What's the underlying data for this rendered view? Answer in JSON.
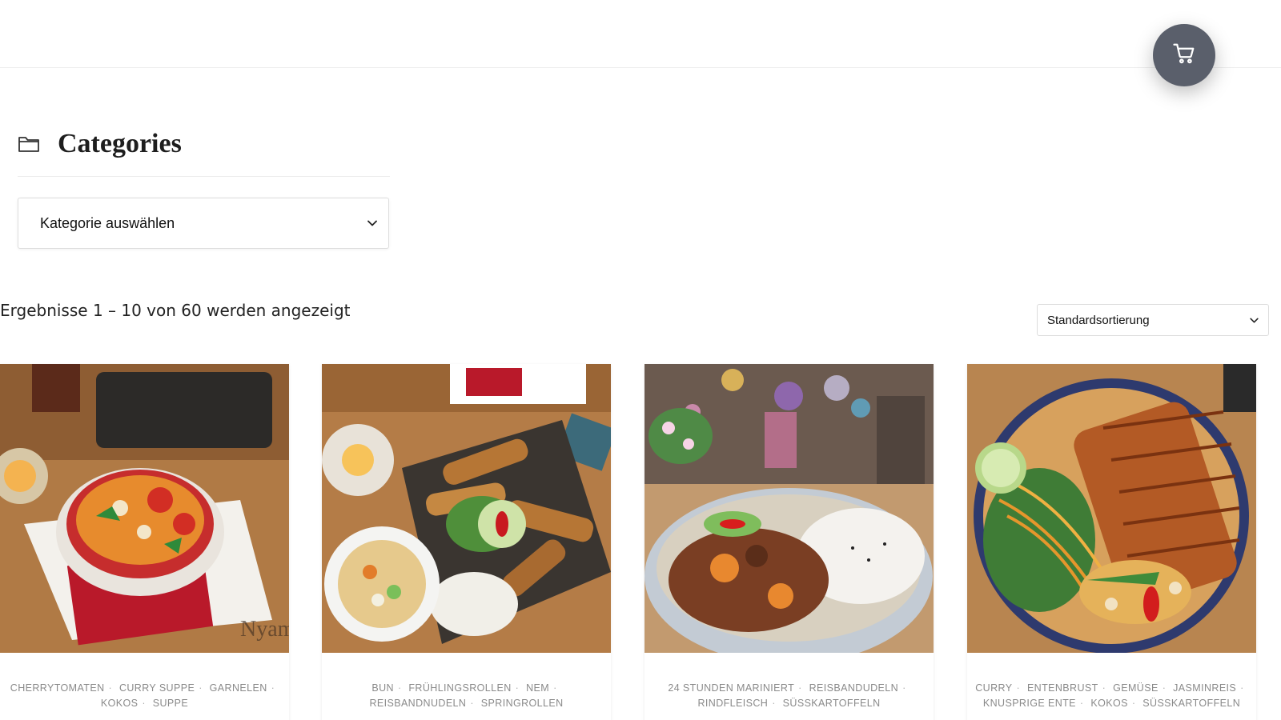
{
  "header": {
    "cart_icon": "cart-icon"
  },
  "categories": {
    "title": "Categories",
    "icon": "folder-icon",
    "select_label": "Kategorie auswählen"
  },
  "results": {
    "count_text": "Ergebnisse 1 – 10 von 60 werden angezeigt"
  },
  "sorting": {
    "selected": "Standardsortierung"
  },
  "products": [
    {
      "tags": [
        "Cherrytomaten",
        "Curry Suppe",
        "Garnelen",
        "Kokos",
        "Suppe"
      ],
      "watermark": "Nyam Nyam"
    },
    {
      "tags": [
        "Bun",
        "Frühlingsrollen",
        "Nem",
        "Reisbandnudeln",
        "Springrollen"
      ]
    },
    {
      "tags": [
        "24 Stunden mariniert",
        "Reisbandudeln",
        "Rindfleisch",
        "Süsskartoffeln"
      ]
    },
    {
      "tags": [
        "Curry",
        "Entenbrust",
        "Gemüse",
        "Jasminreis",
        "Knusprige Ente",
        "Kokos",
        "Süsskartoffeln"
      ]
    }
  ],
  "colors": {
    "cart_button": "#5a5f6b",
    "tag_text": "#8a8a8a",
    "divider": "#eeeeee"
  }
}
